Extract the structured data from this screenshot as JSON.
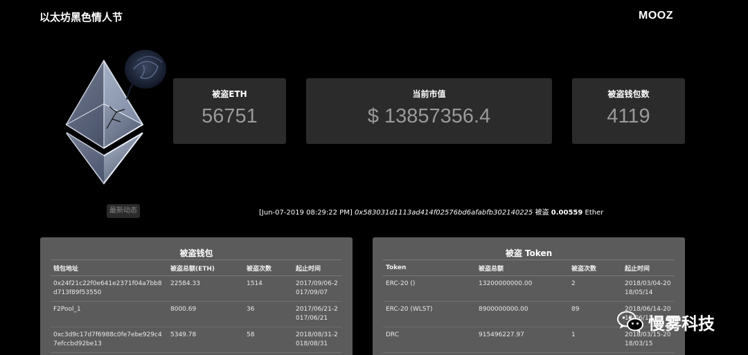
{
  "header": {
    "title": "以太坊黑色情人节",
    "brand": "MOOZ"
  },
  "stats": [
    {
      "label": "被盗ETH",
      "value": "56751"
    },
    {
      "label": "当前市值",
      "value": "$ 13857356.4"
    },
    {
      "label": "被盗钱包数",
      "value": "4119"
    }
  ],
  "news_button": "最新动态",
  "ticker": {
    "time": "[Jun-07-2019 08:29:22 PM]",
    "hash": "0x583031d1113ad414f02576bd6afabfb302140225",
    "action": "被盗",
    "amount": "0.00559",
    "unit": "Ether"
  },
  "wallets_panel": {
    "title": "被盗钱包",
    "columns": [
      "钱包地址",
      "被盗总额(ETH)",
      "被盗次数",
      "起止时间"
    ],
    "rows": [
      [
        "0x24f21c22f0e641e2371f04a7bb8d713f89f53550",
        "22584.33",
        "1514",
        "2017/09/06-2017/09/07"
      ],
      [
        "F2Pool_1",
        "8000.69",
        "36",
        "2017/06/21-2017/06/21"
      ],
      [
        "0xc3d9c17d7f6988c0fe7ebe929c47efccbd92be13",
        "5349.78",
        "58",
        "2018/08/31-2018/08/31"
      ]
    ]
  },
  "tokens_panel": {
    "title": "被盗 Token",
    "columns": [
      "Token",
      "被盗总额",
      "被盗次数",
      "起止时间"
    ],
    "rows": [
      [
        "ERC-20 ()",
        "13200000000.00",
        "2",
        "2018/03/04-2018/05/14"
      ],
      [
        "ERC-20 (WLST)",
        "8900000000.00",
        "89",
        "2018/06/14-2018/06/15"
      ],
      [
        "DRC",
        "915496227.97",
        "1",
        "2018/03/15-2018/03/15"
      ]
    ]
  },
  "watermark": {
    "text": "慢雾科技",
    "icon": "wechat-icon"
  }
}
